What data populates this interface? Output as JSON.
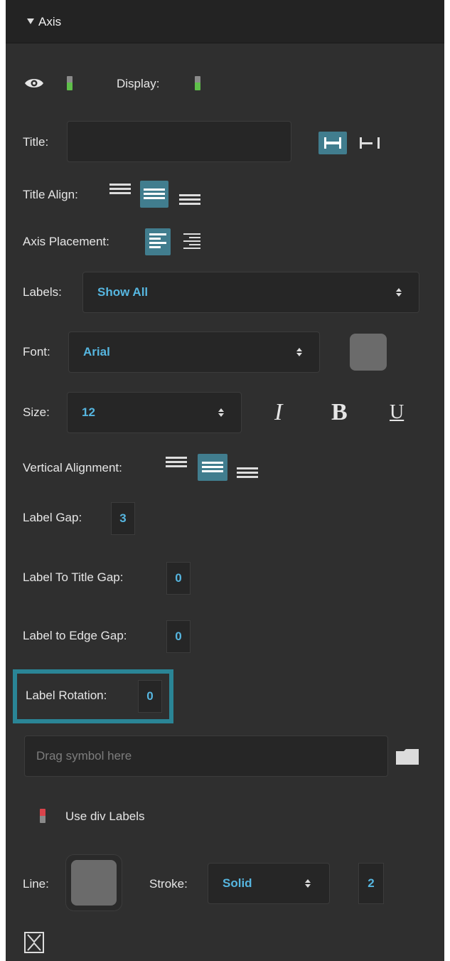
{
  "section": {
    "title": "Axis"
  },
  "visibility": {
    "display_label": "Display:"
  },
  "title": {
    "label": "Title:",
    "value": "",
    "placeholder": ""
  },
  "title_align": {
    "label": "Title Align:",
    "selected": "center"
  },
  "axis_placement": {
    "label": "Axis Placement:",
    "selected": "left"
  },
  "labels": {
    "label": "Labels:",
    "value": "Show All"
  },
  "font": {
    "label": "Font:",
    "value": "Arial",
    "color": "#6b6b6b"
  },
  "size": {
    "label": "Size:",
    "value": "12",
    "italic": "I",
    "bold": "B",
    "underline": "U"
  },
  "vertical_alignment": {
    "label": "Vertical Alignment:",
    "selected": "middle"
  },
  "label_gap": {
    "label": "Label Gap:",
    "value": "3"
  },
  "label_to_title_gap": {
    "label": "Label To Title Gap:",
    "value": "0"
  },
  "label_to_edge_gap": {
    "label": "Label to Edge Gap:",
    "value": "0"
  },
  "label_rotation": {
    "label": "Label Rotation:",
    "value": "0",
    "highlight_color": "#2a8596"
  },
  "symbol": {
    "placeholder": "Drag symbol here"
  },
  "div_labels": {
    "label": "Use div Labels",
    "state_color": "#d9434b"
  },
  "line": {
    "label": "Line:",
    "color": "#6b6b6b",
    "stroke_label": "Stroke:",
    "stroke_value": "Solid",
    "width": "2"
  },
  "colors": {
    "accent": "#56b6e0",
    "selected_bg": "#417d8e",
    "on": "#5fbf4a",
    "panel": "#2f2f2f"
  }
}
